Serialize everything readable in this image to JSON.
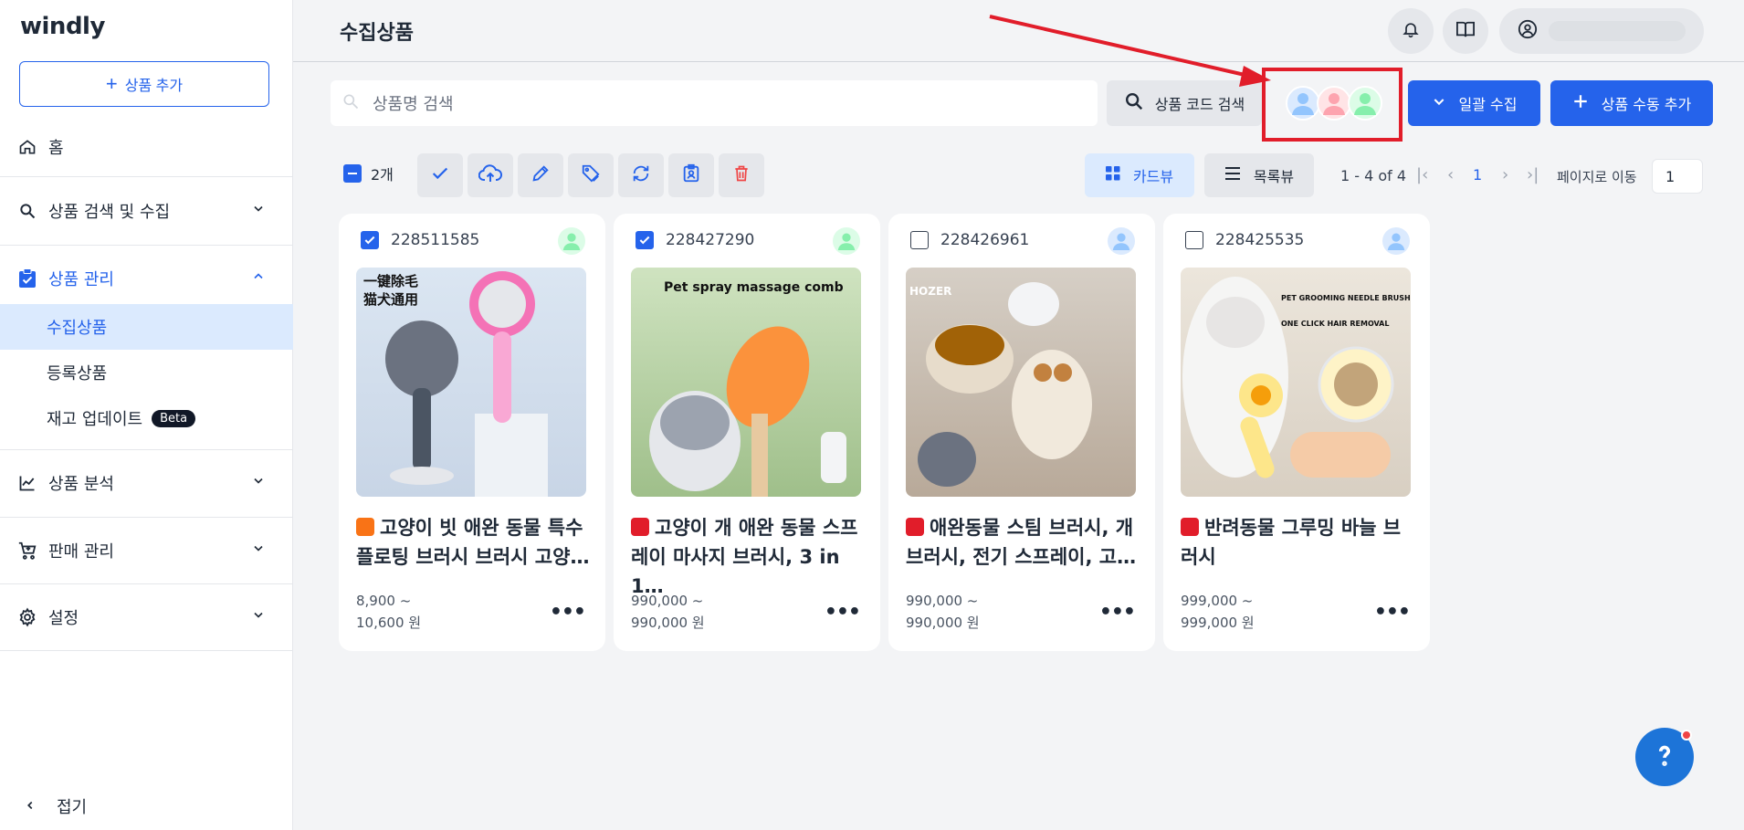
{
  "app": {
    "logo": "windly"
  },
  "sidebar": {
    "add_product": "상품 추가",
    "home": "홈",
    "search_collect": "상품 검색 및 수집",
    "product_mgmt": "상품 관리",
    "sub_items": [
      "수집상품",
      "등록상품",
      "재고 업데이트"
    ],
    "beta": "Beta",
    "analysis": "상품 분석",
    "sales": "판매 관리",
    "settings": "설정",
    "collapse": "접기"
  },
  "header": {
    "title": "수집상품"
  },
  "toolbar": {
    "search_placeholder": "상품명 검색",
    "code_search": "상품 코드 검색",
    "bulk_collect": "일괄 수집",
    "manual_add": "상품 수동 추가",
    "selected_count": "2개",
    "card_view": "카드뷰",
    "list_view": "목록뷰",
    "range": "1 - 4 of 4",
    "current_page": "1",
    "goto_label": "페이지로 이동",
    "goto_value": "1"
  },
  "cards": [
    {
      "code": "228511585",
      "checked": true,
      "title": "고양이 빗 애완 동물 특수 플로팅 브러시 브러시 고양…",
      "price1": "8,900 ~",
      "price2": "10,600 원",
      "source_color": "#f97316",
      "owner_color": "#86efac"
    },
    {
      "code": "228427290",
      "checked": true,
      "title": "고양이 개 애완 동물 스프레이 마사지 브러시, 3 in 1…",
      "price1": "990,000 ~",
      "price2": "990,000 원",
      "source_color": "#e11d2a",
      "owner_color": "#86efac"
    },
    {
      "code": "228426961",
      "checked": false,
      "title": "애완동물 스팀 브러시, 개 브러시, 전기 스프레이, 고…",
      "price1": "990,000 ~",
      "price2": "990,000 원",
      "source_color": "#e11d2a",
      "owner_color": "#93c5fd"
    },
    {
      "code": "228425535",
      "checked": false,
      "title": "반려동물 그루밍 바늘 브러시",
      "price1": "999,000 ~",
      "price2": "999,000 원",
      "source_color": "#e11d2a",
      "owner_color": "#93c5fd"
    }
  ],
  "thumb_text": {
    "card1": [
      "一键除毛",
      "猫犬通用"
    ],
    "card2": "Pet spray massage comb",
    "card3": "HOZER",
    "card4": [
      "PET GROOMING NEEDLE BRUSH",
      "ONE CLICK HAIR REMOVAL"
    ]
  },
  "colors": {
    "accent": "#2563eb",
    "annotation": "#e11d2a",
    "avatar_blue": "#93c5fd",
    "avatar_pink": "#fda4af",
    "avatar_green": "#86efac"
  }
}
